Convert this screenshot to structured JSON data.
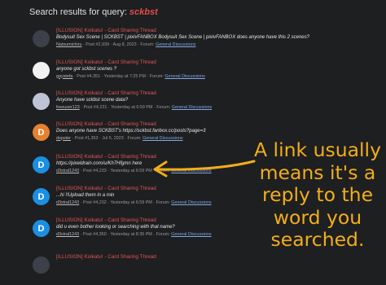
{
  "header": {
    "label": "Search results for query:",
    "query": "sckbst"
  },
  "results": [
    {
      "title": "[ILLUSION] Koikatu! - Card Sharing Thread",
      "snippet": "Bodysuit Sex Scene | SCKBST | pixivFANBOX Bodysuit Sex Scene | pixivFANBOX does anyone have this 2 scenes?",
      "user": "Natsumichiru",
      "post": "Post #2,939",
      "date": "Aug 8, 2023",
      "forum_label": "Forum:",
      "forum": "General Discussions",
      "avatar": "photo-dark"
    },
    {
      "title": "[ILLUSION] Koikatu! - Card Sharing Thread",
      "snippet": "anyone got sckbst scenes ?",
      "user": "gaystefa",
      "post": "Post #4,351",
      "date": "Yesterday at 7:25 PM",
      "forum_label": "Forum:",
      "forum": "General Discussions",
      "avatar": "photo-mono"
    },
    {
      "title": "[ILLUSION] Koikatu! - Card Sharing Thread",
      "snippet": "Anyone have sckbst scene data?",
      "user": "freeuser123",
      "post": "Post #4,231",
      "date": "Yesterday at 6:59 PM",
      "forum_label": "Forum:",
      "forum": "General Discussions",
      "avatar": "photo-anime"
    },
    {
      "title": "[ILLUSION] Koikatu! - Card Sharing Thread",
      "snippet": "Does anyone have SCKBST's https://sckbst.fanbox.cc/posts?page=3",
      "user": "dopster",
      "post": "Post #1,353",
      "date": "Jul 5, 2023",
      "forum_label": "Forum:",
      "forum": "General Discussions",
      "avatar": "letter-d-orange",
      "avatar_letter": "D"
    },
    {
      "title": "[ILLUSION] Koikatu! - Card Sharing Thread",
      "snippet": "https://pixeldrain.com/u/Kh7Hfgmn here",
      "user": "d3xtral1243",
      "post": "Post #4,233",
      "date": "Yesterday at 6:59 PM",
      "forum_label": "Forum:",
      "forum": "General Discussions",
      "avatar": "letter-d-blue",
      "avatar_letter": "D"
    },
    {
      "title": "[ILLUSION] Koikatu! - Card Sharing Thread",
      "snippet": "...hi !!Upload them in a min",
      "user": "d3xtral1243",
      "post": "Post #4,232",
      "date": "Yesterday at 6:59 PM",
      "forum_label": "Forum:",
      "forum": "General Discussions",
      "avatar": "letter-d-blue",
      "avatar_letter": "D"
    },
    {
      "title": "[ILLUSION] Koikatu! - Card Sharing Thread",
      "snippet": "did u even bother looking or searching with that name?",
      "user": "d3xtral1243",
      "post": "Post #4,360",
      "date": "Yesterday at 8:35 PM",
      "forum_label": "Forum:",
      "forum": "General Discussions",
      "avatar": "letter-d-blue",
      "avatar_letter": "D"
    },
    {
      "title": "[ILLUSION] Koikatu! - Card Sharing Thread",
      "snippet": "",
      "user": "",
      "post": "",
      "date": "",
      "forum_label": "",
      "forum": "",
      "avatar": "photo-dark"
    }
  ],
  "annotation": {
    "lines": [
      "A link usually",
      "means it's a",
      "reply to the",
      "word you",
      "searched."
    ],
    "color": "#f2ae1a"
  },
  "colors": {
    "background": "#1e1f21",
    "title": "#e05555",
    "link": "#7fa7e0"
  }
}
